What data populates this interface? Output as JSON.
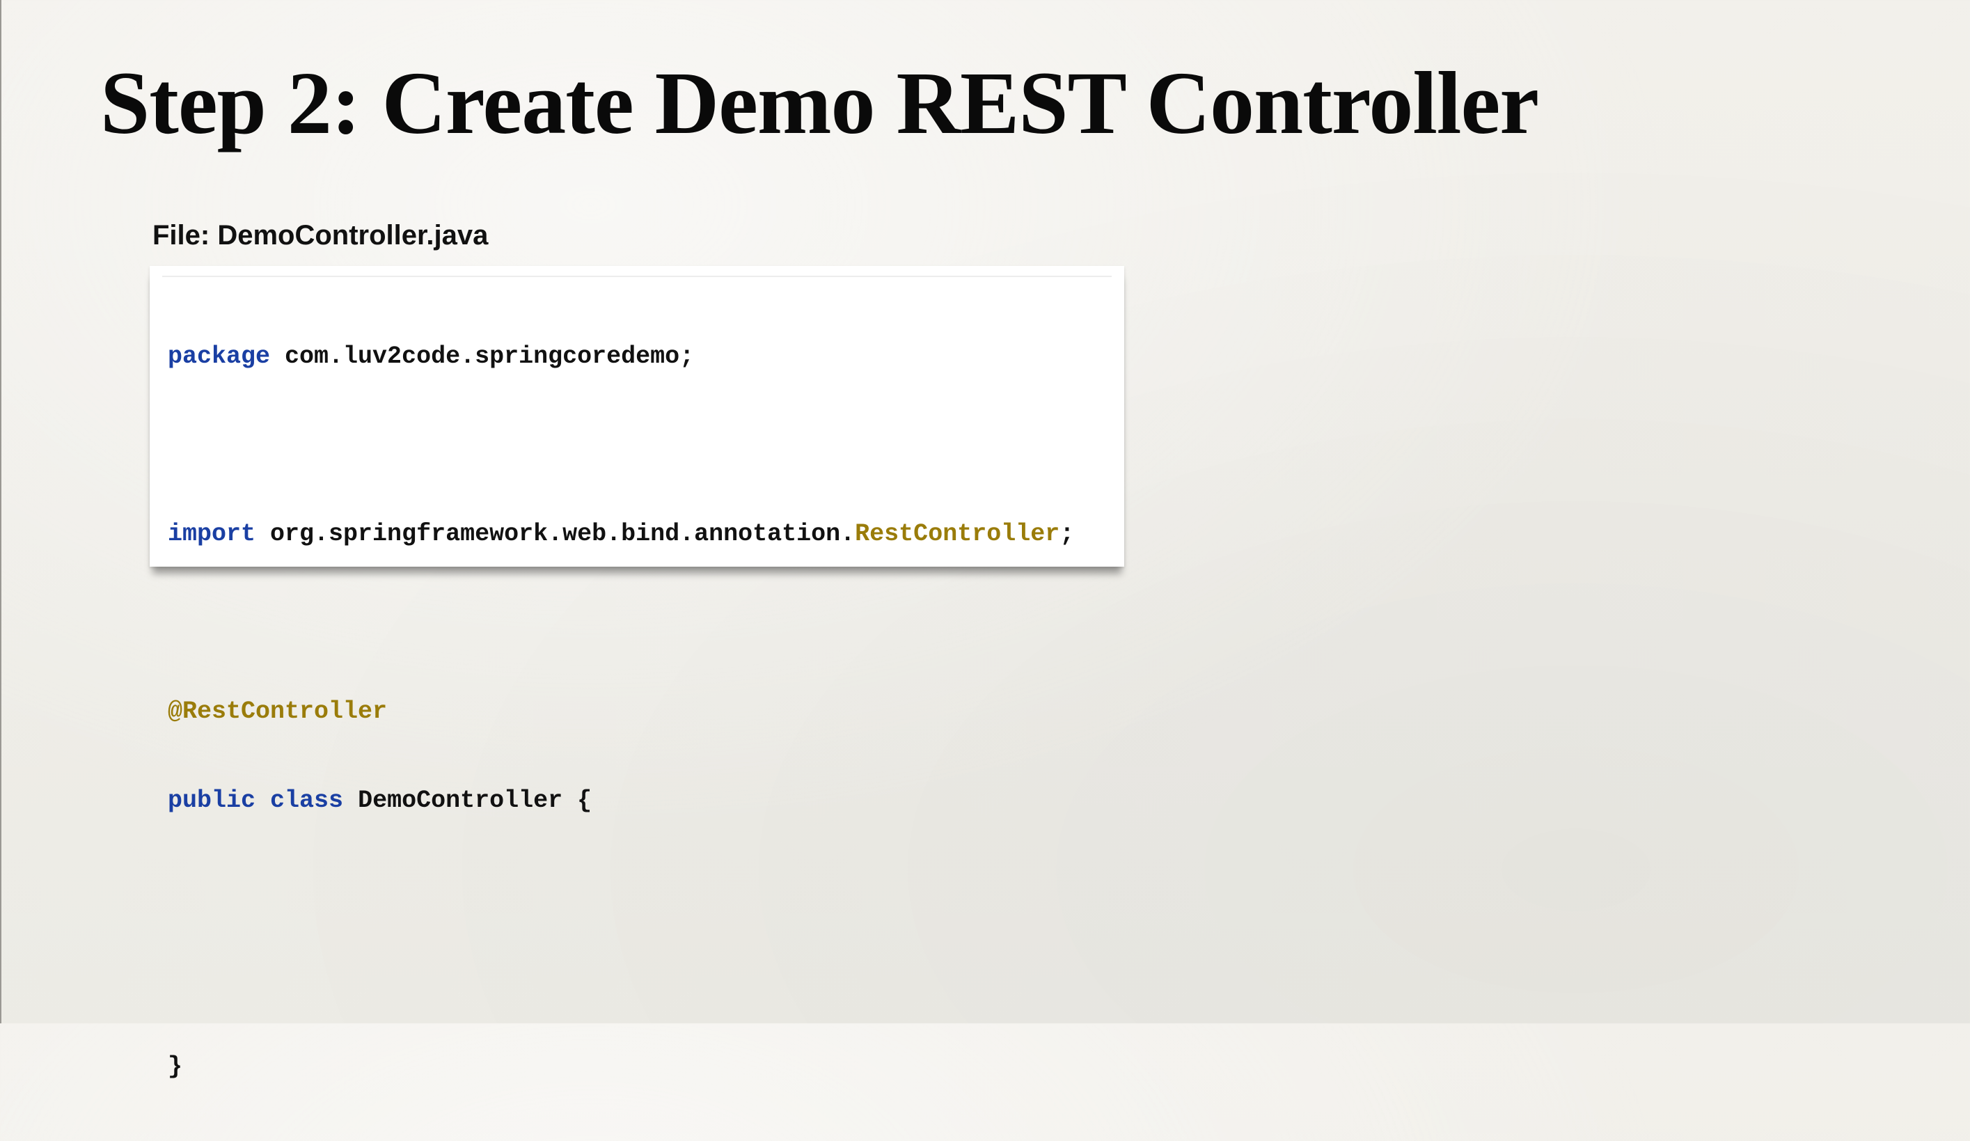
{
  "slide": {
    "title": "Step 2: Create Demo REST Controller",
    "file_label": "File: DemoController.java"
  },
  "colors": {
    "keyword": "#1a3fa3",
    "annotation": "#9a7c0a",
    "text": "#111111",
    "background": "#f1efea"
  },
  "code": {
    "line1": {
      "kw": "package",
      "rest": " com.luv2code.springcoredemo;"
    },
    "line2": "",
    "line3": {
      "kw": "import",
      "mid": " org.springframework.web.bind.annotation.",
      "cls": "RestController",
      "end": ";"
    },
    "line4": "",
    "line5": {
      "ann": "@RestController"
    },
    "line6": {
      "kw1": "public",
      "sp": " ",
      "kw2": "class",
      "rest": " DemoController {"
    },
    "line7": "",
    "line8": "",
    "line9": {
      "rest": "}"
    }
  }
}
